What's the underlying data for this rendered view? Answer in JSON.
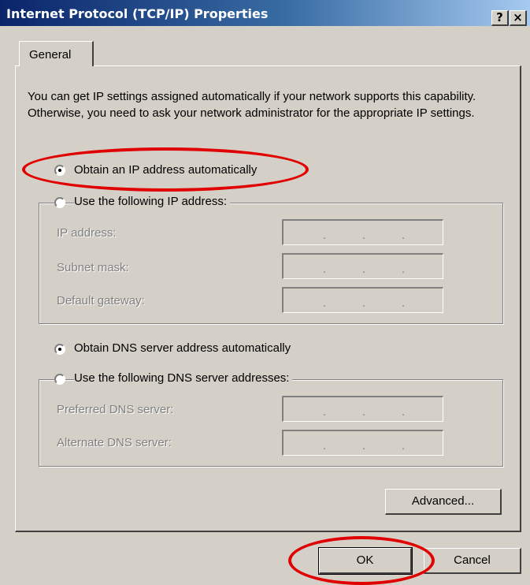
{
  "window": {
    "title": "Internet Protocol (TCP/IP) Properties",
    "help_button": "?",
    "close_button": "×"
  },
  "tabs": [
    {
      "label": "General"
    }
  ],
  "description": "You can get IP settings assigned automatically if your network supports this capability. Otherwise, you need to ask your network administrator for the appropriate IP settings.",
  "ip_section": {
    "obtain_auto_label": "Obtain an IP address automatically",
    "obtain_auto_selected": true,
    "use_following_label": "Use the following IP address:",
    "use_following_selected": false,
    "fields": [
      {
        "label": "IP address:"
      },
      {
        "label": "Subnet mask:"
      },
      {
        "label": "Default gateway:"
      }
    ]
  },
  "dns_section": {
    "obtain_auto_label": "Obtain DNS server address automatically",
    "obtain_auto_selected": true,
    "use_following_label": "Use the following DNS server addresses:",
    "use_following_selected": false,
    "fields": [
      {
        "label": "Preferred DNS server:"
      },
      {
        "label": "Alternate DNS server:"
      }
    ]
  },
  "buttons": {
    "advanced": "Advanced...",
    "ok": "OK",
    "cancel": "Cancel"
  },
  "annotation_color": "#e00000"
}
